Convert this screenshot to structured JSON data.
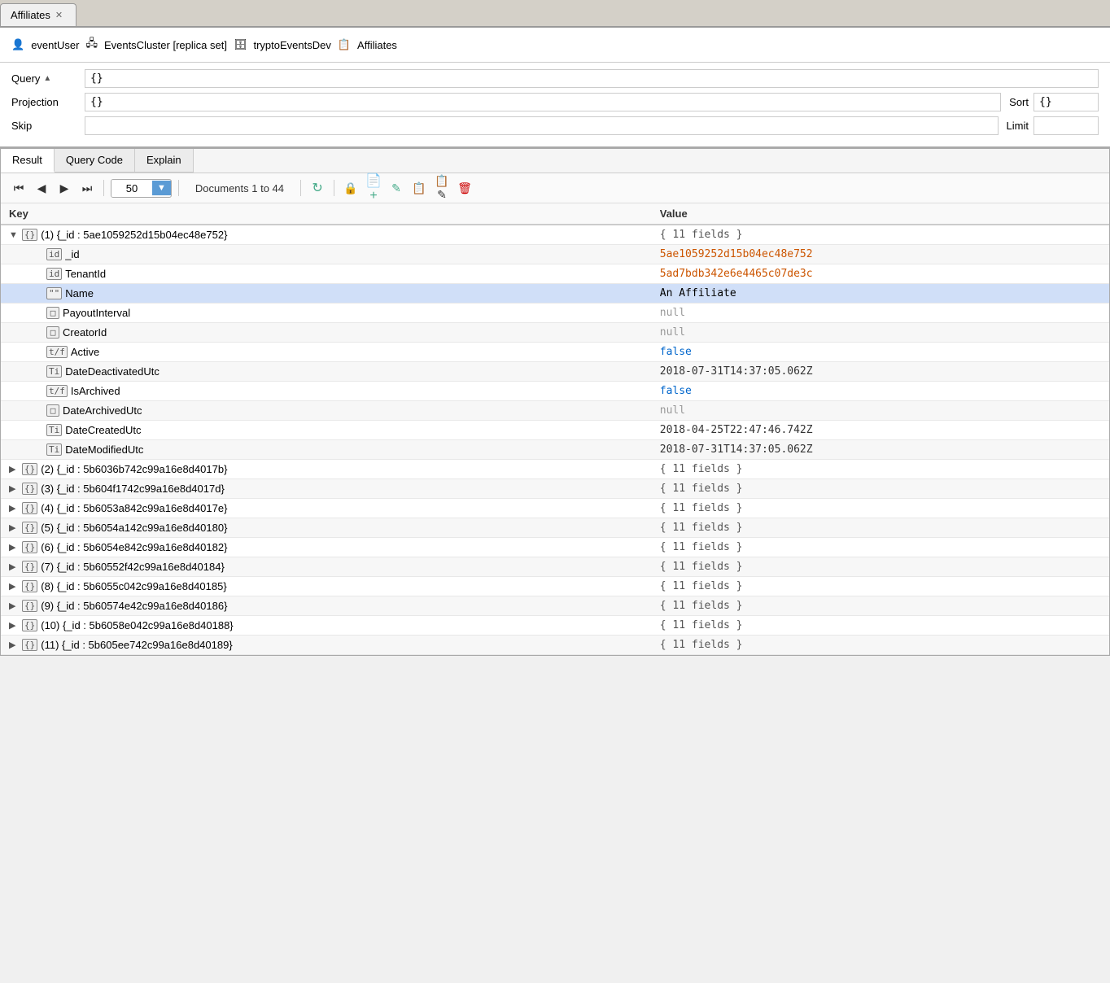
{
  "tab": {
    "label": "Affiliates",
    "close": "✕"
  },
  "breadcrumb": {
    "user_icon": "👤",
    "user": "eventUser",
    "cluster_icon": "🖧",
    "cluster": "EventsCluster [replica set]",
    "db_icon": "🗄",
    "db": "tryptoEventsDev",
    "coll_icon": "📋",
    "coll": "Affiliates"
  },
  "query": {
    "label": "Query",
    "sort_icon": "▲",
    "query_value": "{}",
    "projection_label": "Projection",
    "projection_value": "{}",
    "sort_label": "Sort",
    "sort_value": "{}",
    "skip_label": "Skip",
    "skip_value": "",
    "limit_label": "Limit",
    "limit_value": ""
  },
  "result_tabs": [
    {
      "label": "Result",
      "active": true
    },
    {
      "label": "Query Code",
      "active": false
    },
    {
      "label": "Explain",
      "active": false
    }
  ],
  "toolbar": {
    "page_size": "50",
    "doc_count": "Documents 1 to 44"
  },
  "table": {
    "headers": [
      "Key",
      "Value"
    ],
    "rows": [
      {
        "indent": 0,
        "expandable": true,
        "expanded": true,
        "icon": "{}",
        "key": "(1) {_id : 5ae1059252d15b04ec48e752}",
        "value": "{ 11 fields }",
        "value_type": "fields",
        "selected": false
      },
      {
        "indent": 1,
        "expandable": false,
        "expanded": false,
        "icon": "id",
        "key": "_id",
        "value": "5ae1059252d15b04ec48e752",
        "value_type": "id",
        "selected": false
      },
      {
        "indent": 1,
        "expandable": false,
        "expanded": false,
        "icon": "id",
        "key": "TenantId",
        "value": "5ad7bdb342e6e4465c07de3c",
        "value_type": "id",
        "selected": false
      },
      {
        "indent": 1,
        "expandable": false,
        "expanded": false,
        "icon": "\"\"",
        "key": "Name",
        "value": "An Affiliate",
        "value_type": "string",
        "selected": true
      },
      {
        "indent": 1,
        "expandable": false,
        "expanded": false,
        "icon": "□",
        "key": "PayoutInterval",
        "value": "null",
        "value_type": "null",
        "selected": false
      },
      {
        "indent": 1,
        "expandable": false,
        "expanded": false,
        "icon": "□",
        "key": "CreatorId",
        "value": "null",
        "value_type": "null",
        "selected": false
      },
      {
        "indent": 1,
        "expandable": false,
        "expanded": false,
        "icon": "t/f",
        "key": "Active",
        "value": "false",
        "value_type": "bool",
        "selected": false
      },
      {
        "indent": 1,
        "expandable": false,
        "expanded": false,
        "icon": "Ti",
        "key": "DateDeactivatedUtc",
        "value": "2018-07-31T14:37:05.062Z",
        "value_type": "date",
        "selected": false
      },
      {
        "indent": 1,
        "expandable": false,
        "expanded": false,
        "icon": "t/f",
        "key": "IsArchived",
        "value": "false",
        "value_type": "bool",
        "selected": false
      },
      {
        "indent": 1,
        "expandable": false,
        "expanded": false,
        "icon": "□",
        "key": "DateArchivedUtc",
        "value": "null",
        "value_type": "null",
        "selected": false
      },
      {
        "indent": 1,
        "expandable": false,
        "expanded": false,
        "icon": "Ti",
        "key": "DateCreatedUtc",
        "value": "2018-04-25T22:47:46.742Z",
        "value_type": "date",
        "selected": false
      },
      {
        "indent": 1,
        "expandable": false,
        "expanded": false,
        "icon": "Ti",
        "key": "DateModifiedUtc",
        "value": "2018-07-31T14:37:05.062Z",
        "value_type": "date",
        "selected": false
      },
      {
        "indent": 0,
        "expandable": true,
        "expanded": false,
        "icon": "{}",
        "key": "(2) {_id : 5b6036b742c99a16e8d4017b}",
        "value": "{ 11 fields }",
        "value_type": "fields",
        "selected": false
      },
      {
        "indent": 0,
        "expandable": true,
        "expanded": false,
        "icon": "{}",
        "key": "(3) {_id : 5b604f1742c99a16e8d4017d}",
        "value": "{ 11 fields }",
        "value_type": "fields",
        "selected": false
      },
      {
        "indent": 0,
        "expandable": true,
        "expanded": false,
        "icon": "{}",
        "key": "(4) {_id : 5b6053a842c99a16e8d4017e}",
        "value": "{ 11 fields }",
        "value_type": "fields",
        "selected": false
      },
      {
        "indent": 0,
        "expandable": true,
        "expanded": false,
        "icon": "{}",
        "key": "(5) {_id : 5b6054a142c99a16e8d40180}",
        "value": "{ 11 fields }",
        "value_type": "fields",
        "selected": false
      },
      {
        "indent": 0,
        "expandable": true,
        "expanded": false,
        "icon": "{}",
        "key": "(6) {_id : 5b6054e842c99a16e8d40182}",
        "value": "{ 11 fields }",
        "value_type": "fields",
        "selected": false
      },
      {
        "indent": 0,
        "expandable": true,
        "expanded": false,
        "icon": "{}",
        "key": "(7) {_id : 5b60552f42c99a16e8d40184}",
        "value": "{ 11 fields }",
        "value_type": "fields",
        "selected": false
      },
      {
        "indent": 0,
        "expandable": true,
        "expanded": false,
        "icon": "{}",
        "key": "(8) {_id : 5b6055c042c99a16e8d40185}",
        "value": "{ 11 fields }",
        "value_type": "fields",
        "selected": false
      },
      {
        "indent": 0,
        "expandable": true,
        "expanded": false,
        "icon": "{}",
        "key": "(9) {_id : 5b60574e42c99a16e8d40186}",
        "value": "{ 11 fields }",
        "value_type": "fields",
        "selected": false
      },
      {
        "indent": 0,
        "expandable": true,
        "expanded": false,
        "icon": "{}",
        "key": "(10) {_id : 5b6058e042c99a16e8d40188}",
        "value": "{ 11 fields }",
        "value_type": "fields",
        "selected": false
      },
      {
        "indent": 0,
        "expandable": true,
        "expanded": false,
        "icon": "{}",
        "key": "(11) {_id : 5b605ee742c99a16e8d40189}",
        "value": "{ 11 fields }",
        "value_type": "fields",
        "selected": false
      }
    ]
  }
}
